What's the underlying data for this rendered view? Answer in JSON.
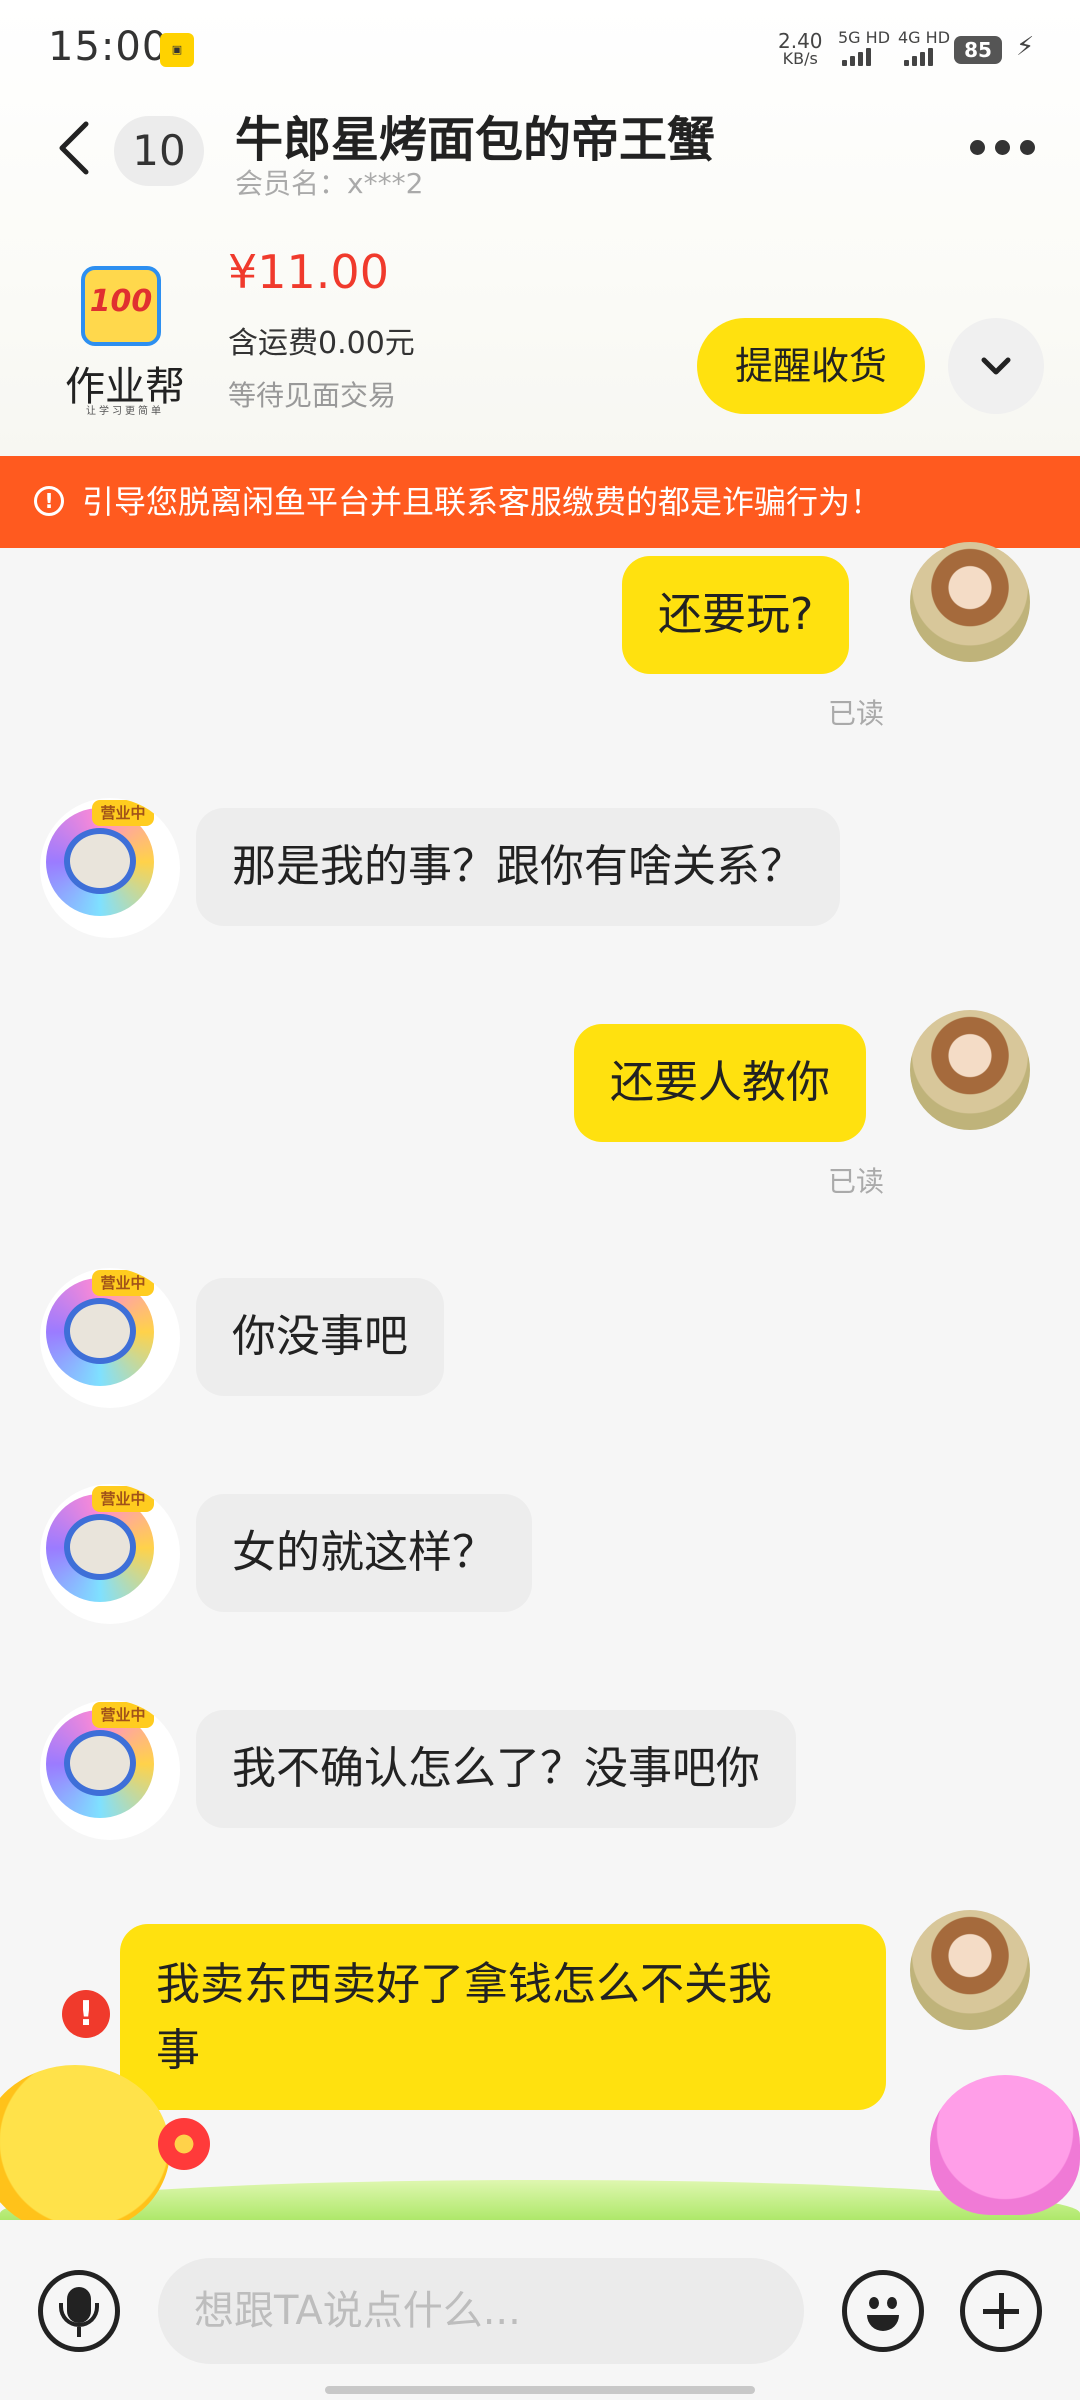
{
  "status_bar": {
    "time": "15:00",
    "net_speed": "2.40",
    "net_unit": "KB/s",
    "sig1_label": "5G HD",
    "sig2_label": "4G HD",
    "battery": "85",
    "notification_icon": "app-notification-icon"
  },
  "header": {
    "back_icon": "chevron-left-icon",
    "unread_count": "10",
    "title": "牛郎星烤面包的帝王蟹",
    "subtitle": "会员名：x***2",
    "more_icon": "more-dots-icon"
  },
  "product": {
    "logo_text": "100",
    "logo_name": "作业帮",
    "logo_slogan": "让学习更简单",
    "price": "¥11.00",
    "shipping": "含运费0.00元",
    "status": "等待见面交易",
    "remind_button": "提醒收货",
    "expand_icon": "chevron-down-icon"
  },
  "warning": {
    "icon": "alert-circle-icon",
    "text": "引导您脱离闲鱼平台并且联系客服缴费的都是诈骗行为！"
  },
  "messages": [
    {
      "sender": "me",
      "text": "还要玩?",
      "read": "已读"
    },
    {
      "sender": "them",
      "text": "那是我的事？跟你有啥关系？",
      "avatar_tag": "营业中"
    },
    {
      "sender": "me",
      "text": "还要人教你",
      "read": "已读"
    },
    {
      "sender": "them",
      "text": "你没事吧",
      "avatar_tag": "营业中"
    },
    {
      "sender": "them",
      "text": "女的就这样？",
      "avatar_tag": "营业中"
    },
    {
      "sender": "them",
      "text": "我不确认怎么了？没事吧你",
      "avatar_tag": "营业中"
    },
    {
      "sender": "me",
      "text_line1": "我卖东西卖好了拿钱怎么不关我",
      "text_line2": "事",
      "status": "failed"
    }
  ],
  "input_bar": {
    "voice_icon": "microphone-icon",
    "placeholder": "想跟TA说点什么...",
    "emoji_icon": "emoji-icon",
    "plus_icon": "plus-icon"
  }
}
